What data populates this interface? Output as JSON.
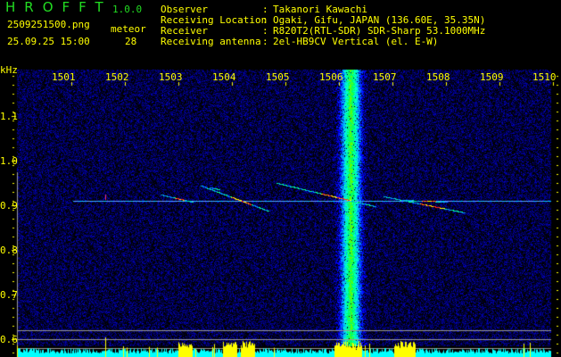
{
  "app": {
    "title": "HROFFT",
    "version": "1.0.0"
  },
  "file": {
    "name": "2509251500.png",
    "datetime": "25.09.25 15:00"
  },
  "meteor": {
    "label": "meteor",
    "count": "28"
  },
  "info": [
    {
      "label": "Observer",
      "value": "Takanori Kawachi"
    },
    {
      "label": "Receiving Location",
      "value": "Ogaki, Gifu, JAPAN (136.60E, 35.35N)"
    },
    {
      "label": "Receiver",
      "value": "R820T2(RTL-SDR) SDR-Sharp 53.1000MHz"
    },
    {
      "label": "Receiving antenna",
      "value": "2el-HB9CV Vertical (el. E-W)"
    }
  ],
  "axis": {
    "unit": "kHz",
    "freq_ticks": [
      "1501",
      "1502",
      "1503",
      "1504",
      "1505",
      "1506",
      "1507",
      "1508",
      "1509",
      "1510"
    ],
    "khz_ticks": [
      "1.1",
      "1.0",
      "0.9",
      "0.8",
      "0.7",
      "0.6"
    ]
  },
  "colors": {
    "text": "#ffff00",
    "title": "#22dd22",
    "noise": "#0000aa",
    "spectrum": "#00ffff",
    "spectrum_peak": "#ffff00"
  }
}
